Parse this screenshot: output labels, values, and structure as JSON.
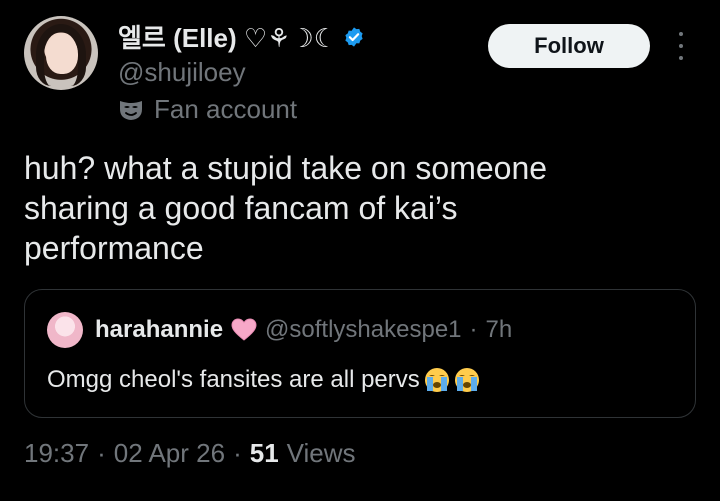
{
  "author": {
    "display_name": "엘르 (Elle) ♡⚘☽☾",
    "handle": "@shujiloey",
    "label": "Fan account",
    "avatar_icon": "profile-photo",
    "verified_color": "#1d9bf0"
  },
  "follow_button": {
    "label": "Follow"
  },
  "tweet": {
    "text": "huh? what a stupid take on someone\nsharing a good fancam of kai’s\nperformance"
  },
  "quote": {
    "display_name": "harahannie",
    "heart_icon": "pink-heart",
    "handle": "@softlyshakespe1",
    "separator": "·",
    "time": "7h",
    "text": "Omgg cheol's fansites are all pervs",
    "emoji_icon": "loudly-crying-face"
  },
  "meta": {
    "time": "19:37",
    "sep1": "·",
    "date": "02 Apr 26",
    "sep2": "·",
    "views_count": "51",
    "views_label": "Views"
  },
  "colors": {
    "background": "#000000",
    "text": "#e7e9ea",
    "secondary": "#71767b",
    "border": "#2f3336",
    "accent": "#1d9bf0"
  }
}
